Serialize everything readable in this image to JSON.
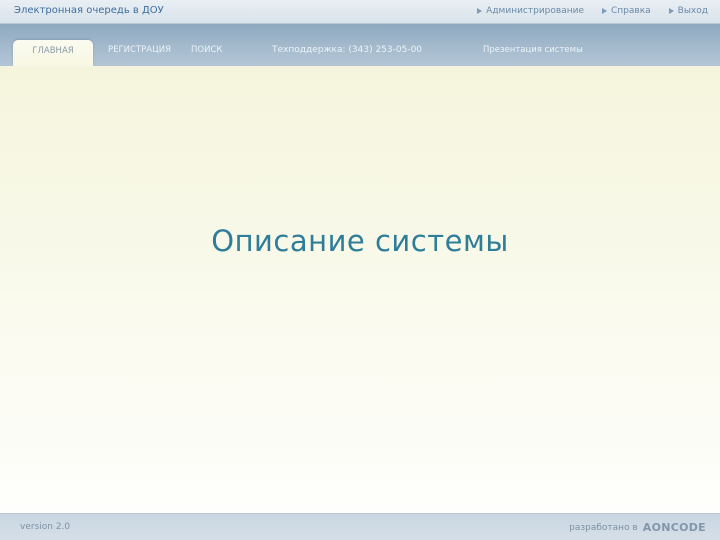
{
  "header": {
    "app_title": "Электронная очередь в ДОУ",
    "links": [
      {
        "label": "Администрирование",
        "icon": "triangle-right-icon"
      },
      {
        "label": "Справка",
        "icon": "triangle-right-icon"
      },
      {
        "label": "Выход",
        "icon": "triangle-right-icon"
      }
    ]
  },
  "nav": {
    "tabs": [
      {
        "label": "ГЛАВНАЯ",
        "active": true
      },
      {
        "label": "РЕГИСТРАЦИЯ",
        "active": false
      },
      {
        "label": "ПОИСК",
        "active": false
      }
    ],
    "support": "Техподдержка: (343) 253-05-00",
    "presentation": "Презентация системы"
  },
  "main": {
    "title": "Описание системы"
  },
  "footer": {
    "version": "version 2.0",
    "developed_by": "разработано в",
    "logo": "AONCODE"
  },
  "colors": {
    "accent": "#2f7d99",
    "nav": "#a2b9cc",
    "content_bg": "#f7f7e3"
  }
}
